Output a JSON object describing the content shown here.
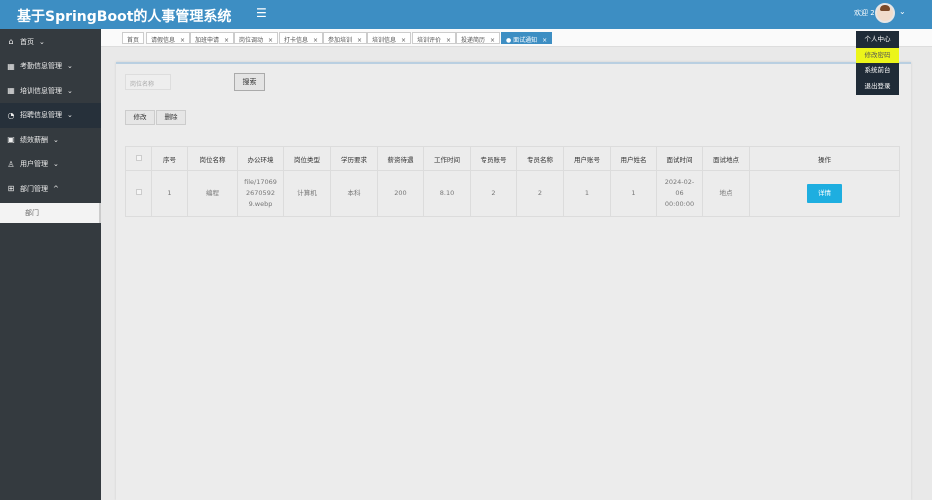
{
  "header": {
    "title": "基于SpringBoot的人事管理系统",
    "menu_icon": "hamburger-icon",
    "welcome": "欢迎 2"
  },
  "user_menu": {
    "items": [
      "个人中心",
      "修改密码",
      "系统前台",
      "退出登录"
    ],
    "highlighted": 1,
    "highlight_color": "#ecf51a"
  },
  "sidebar": {
    "items": [
      {
        "label": "首页",
        "icon": "home-icon"
      },
      {
        "label": "考勤信息管理",
        "icon": "grid-icon"
      },
      {
        "label": "培训信息管理",
        "icon": "grid-icon"
      },
      {
        "label": "招聘信息管理",
        "icon": "pie-icon",
        "active": true
      },
      {
        "label": "绩效薪酬",
        "icon": "contact-icon"
      },
      {
        "label": "用户管理",
        "icon": "user-icon"
      },
      {
        "label": "部门管理",
        "icon": "apps-icon",
        "expanded": true
      }
    ],
    "sub_item": "部门"
  },
  "tabs": [
    {
      "label": "首页"
    },
    {
      "label": "请假信息"
    },
    {
      "label": "加班申请"
    },
    {
      "label": "岗位调动"
    },
    {
      "label": "打卡信息"
    },
    {
      "label": "参加培训"
    },
    {
      "label": "培训信息"
    },
    {
      "label": "培训评价"
    },
    {
      "label": "投递简历"
    },
    {
      "label": "● 面试通知",
      "active": true
    }
  ],
  "toolbar": {
    "search_placeholder": "岗位名称",
    "search_label": "搜索",
    "edit_label": "修改",
    "delete_label": "删除"
  },
  "table": {
    "headers": [
      "序号",
      "岗位名称",
      "办公环境",
      "岗位类型",
      "学历要求",
      "薪资待遇",
      "工作时间",
      "专员账号",
      "专员名称",
      "用户账号",
      "用户姓名",
      "面试时间",
      "面试地点",
      "操作"
    ],
    "rows": [
      [
        "1",
        "编程",
        "file/1706926705929.webp",
        "计算机",
        "本科",
        "200",
        "8.10",
        "2",
        "2",
        "1",
        "1",
        "2024-02-06 00:00:00",
        "地点",
        "详情"
      ]
    ]
  },
  "colors": {
    "header": "#3d8ec3",
    "sidebar": "#343a3f",
    "detail_button": "#1eaee0"
  }
}
